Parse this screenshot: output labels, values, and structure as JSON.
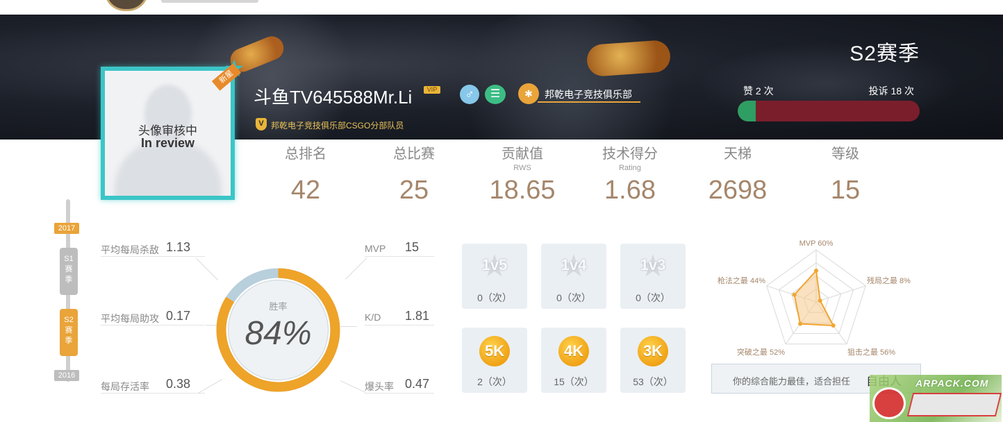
{
  "header": {
    "season_title": "S2赛季",
    "likes_text": "赞 2 次",
    "complaints_text": "投诉 18 次",
    "vote_ratio": 0.1
  },
  "profile": {
    "avatar_status_cn": "头像审核中",
    "avatar_status_en": "In review",
    "new_tag": "新星",
    "name": "斗鱼TV645588Mr.Li",
    "vip_label": "VIP",
    "gender_icon": "male-icon",
    "club_name": "邦乾电子竞技俱乐部",
    "role_badge": "V",
    "club_role": "邦乾电子竞技俱乐部CSGO分部队员"
  },
  "overall": [
    {
      "label": "总排名",
      "sub": "",
      "value": "42"
    },
    {
      "label": "总比赛",
      "sub": "",
      "value": "25"
    },
    {
      "label": "贡献值",
      "sub": "RWS",
      "value": "18.65"
    },
    {
      "label": "技术得分",
      "sub": "Rating",
      "value": "1.68"
    },
    {
      "label": "天梯",
      "sub": "",
      "value": "2698"
    },
    {
      "label": "等级",
      "sub": "",
      "value": "15"
    }
  ],
  "timeline": {
    "year_top": "2017",
    "year_bottom": "2016",
    "seasons": [
      {
        "label": "S1 赛 季",
        "active": false
      },
      {
        "label": "S2 赛 季",
        "active": true
      }
    ]
  },
  "left_stats": [
    {
      "label": "平均每局杀敌",
      "value": "1.13"
    },
    {
      "label": "平均每局助攻",
      "value": "0.17"
    },
    {
      "label": "每局存活率",
      "value": "0.38"
    }
  ],
  "right_stats": [
    {
      "label": "MVP",
      "value": "15"
    },
    {
      "label": "K/D",
      "value": "1.81"
    },
    {
      "label": "爆头率",
      "value": "0.47"
    }
  ],
  "win_rate": {
    "label": "胜率",
    "value_text": "84%",
    "fraction": 0.84
  },
  "clutches": [
    {
      "badge": "1v5",
      "count": "0（次）"
    },
    {
      "badge": "1v4",
      "count": "0（次）"
    },
    {
      "badge": "1v3",
      "count": "0（次）"
    }
  ],
  "multikills": [
    {
      "badge": "5K",
      "count": "2（次）"
    },
    {
      "badge": "4K",
      "count": "15（次）"
    },
    {
      "badge": "3K",
      "count": "53（次）"
    }
  ],
  "radar": {
    "axes": [
      {
        "label": "MVP 60%",
        "value": 0.6
      },
      {
        "label": "残局之最 8%",
        "value": 0.08
      },
      {
        "label": "狙击之最 56%",
        "value": 0.56
      },
      {
        "label": "突破之最 52%",
        "value": 0.52
      },
      {
        "label": "枪法之最 44%",
        "value": 0.44
      }
    ],
    "fill_color": "#f6c98a",
    "stroke_color": "#f0a631"
  },
  "best_role": {
    "message": "你的综合能力最佳，适合担任",
    "role": "自由人"
  },
  "watermark": {
    "site": "ARPACK.COM"
  }
}
